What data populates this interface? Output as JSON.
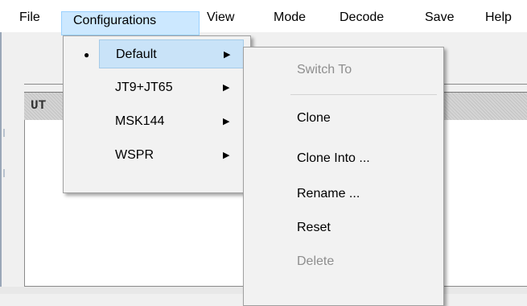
{
  "menubar": {
    "items": [
      "File",
      "Configurations",
      "View",
      "Mode",
      "Decode",
      "Save",
      "Help"
    ],
    "active_index": 1
  },
  "window": {
    "panel_header": "UT"
  },
  "configurations_menu": {
    "items": [
      {
        "label": "Default",
        "selected": true
      },
      {
        "label": "JT9+JT65",
        "selected": false
      },
      {
        "label": "MSK144",
        "selected": false
      },
      {
        "label": "WSPR",
        "selected": false
      }
    ]
  },
  "submenu": {
    "items": [
      {
        "label": "Switch To",
        "enabled": false
      },
      {
        "label": "Clone",
        "enabled": true
      },
      {
        "label": "Clone Into ...",
        "enabled": true
      },
      {
        "label": "Rename ...",
        "enabled": true
      },
      {
        "label": "Reset",
        "enabled": true
      },
      {
        "label": "Delete",
        "enabled": false
      }
    ]
  },
  "icons": {
    "selected_bullet": "bullet-icon",
    "submenu_arrow": "arrow-right-icon"
  },
  "colors": {
    "menu_highlight": "#cce8ff",
    "item_highlight": "#c9e3f8",
    "disabled_text": "#8e8e8e"
  }
}
